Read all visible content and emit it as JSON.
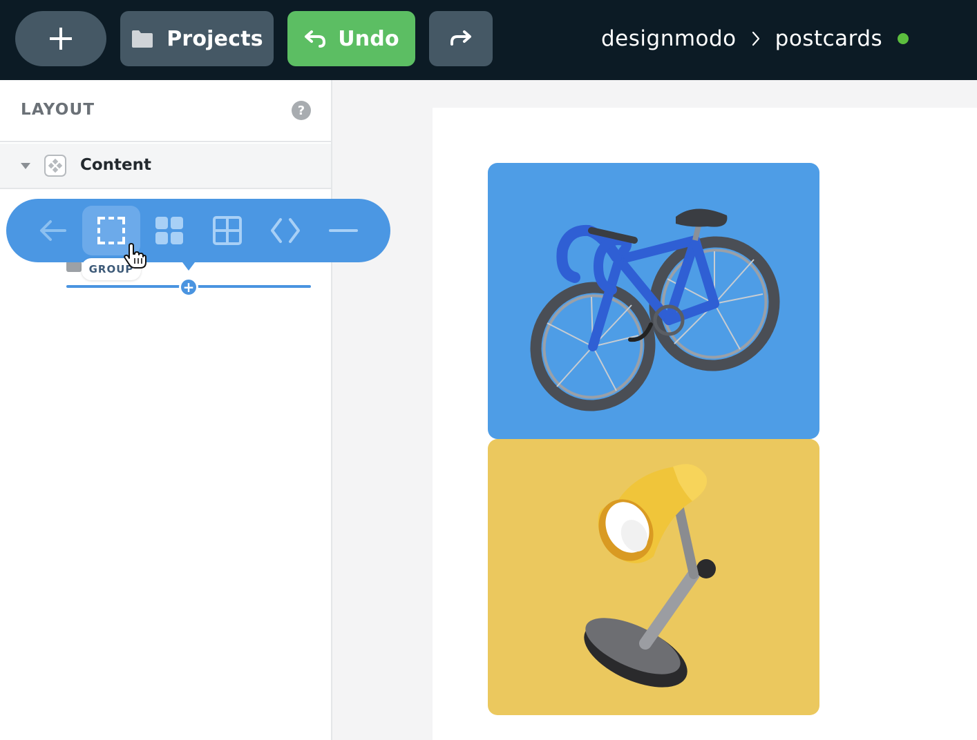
{
  "topbar": {
    "add_icon": "plus-icon",
    "projects_label": "Projects",
    "projects_icon": "folder-icon",
    "undo_label": "Undo",
    "undo_icon": "undo-arrow-icon",
    "redo_icon": "redo-arrow-icon"
  },
  "breadcrumb": {
    "items": [
      "designmodo",
      "postcards"
    ],
    "separator_icon": "chevron-right-icon",
    "status_color": "#5cbe3e"
  },
  "sidebar": {
    "title": "LAYOUT",
    "help_label": "?",
    "tree": [
      {
        "label": "Content",
        "expanded": true,
        "icon": "block-icon"
      }
    ]
  },
  "floating_toolbar": {
    "buttons": [
      {
        "name": "back",
        "icon": "arrow-left-icon"
      },
      {
        "name": "group",
        "icon": "select-frame-icon",
        "active": true
      },
      {
        "name": "grid",
        "icon": "grid-blocks-icon"
      },
      {
        "name": "table",
        "icon": "table-grid-icon"
      },
      {
        "name": "code",
        "icon": "code-brackets-icon"
      },
      {
        "name": "divider",
        "icon": "minus-icon"
      }
    ],
    "tooltip": "GROUP"
  },
  "canvas": {
    "cards": [
      {
        "name": "bike",
        "background": "#4e9de6",
        "illustration": "bicycle-illustration"
      },
      {
        "name": "lamp",
        "background": "#ebc85e",
        "illustration": "desk-lamp-illustration"
      }
    ]
  },
  "colors": {
    "topbar_bg": "#0c1b25",
    "button_gray": "#455865",
    "undo_green": "#5cbe63",
    "accent_blue": "#4b97e3"
  }
}
